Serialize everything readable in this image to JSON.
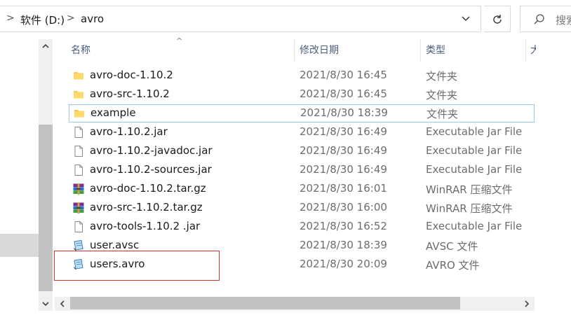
{
  "address_bar": {
    "crumbs": [
      "软件 (D:)",
      "avro"
    ]
  },
  "search": {
    "placeholder": "搜索"
  },
  "columns": {
    "name": "名称",
    "date": "修改日期",
    "type": "类型",
    "size_partial": "大"
  },
  "files": [
    {
      "name": "avro-doc-1.10.2",
      "date": "2021/8/30 16:45",
      "type": "文件夹",
      "icon": "folder-icon"
    },
    {
      "name": "avro-src-1.10.2",
      "date": "2021/8/30 16:45",
      "type": "文件夹",
      "icon": "folder-icon"
    },
    {
      "name": "example",
      "date": "2021/8/30 18:39",
      "type": "文件夹",
      "icon": "folder-icon"
    },
    {
      "name": "avro-1.10.2.jar",
      "date": "2021/8/30 16:49",
      "type": "Executable Jar File",
      "icon": "file-icon"
    },
    {
      "name": "avro-1.10.2-javadoc.jar",
      "date": "2021/8/30 16:49",
      "type": "Executable Jar File",
      "icon": "file-icon"
    },
    {
      "name": "avro-1.10.2-sources.jar",
      "date": "2021/8/30 16:49",
      "type": "Executable Jar File",
      "icon": "file-icon"
    },
    {
      "name": "avro-doc-1.10.2.tar.gz",
      "date": "2021/8/30 16:01",
      "type": "WinRAR 压缩文件",
      "icon": "winrar-icon"
    },
    {
      "name": "avro-src-1.10.2.tar.gz",
      "date": "2021/8/30 16:00",
      "type": "WinRAR 压缩文件",
      "icon": "winrar-icon"
    },
    {
      "name": "avro-tools-1.10.2 .jar",
      "date": "2021/8/30 16:52",
      "type": "Executable Jar File",
      "icon": "file-icon"
    },
    {
      "name": "user.avsc",
      "date": "2021/8/30 18:39",
      "type": "AVSC 文件",
      "icon": "notepad-file-icon"
    },
    {
      "name": "users.avro",
      "date": "2021/8/30 20:09",
      "type": "AVRO 文件",
      "icon": "notepad-file-icon"
    }
  ],
  "colors": {
    "header_text": "#4b5e7d",
    "selection_border": "#99c9f3",
    "annotation_box": "#d9312a",
    "folder": "#f7c948"
  }
}
